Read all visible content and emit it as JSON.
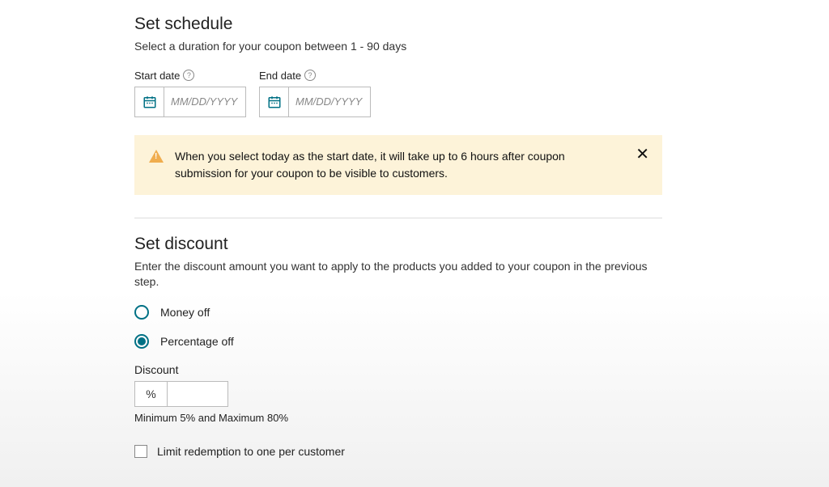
{
  "schedule": {
    "heading": "Set schedule",
    "subtext": "Select a duration for your coupon between 1 - 90 days",
    "start_label": "Start date",
    "end_label": "End date",
    "placeholder": "MM/DD/YYYY"
  },
  "alert": {
    "text": "When you select today as the start date, it will take up to 6 hours after coupon submission for your coupon to be visible to customers."
  },
  "discount": {
    "heading": "Set discount",
    "subtext": "Enter the discount amount you want to apply to the products you added to your coupon in the previous step.",
    "money_off_label": "Money off",
    "percentage_off_label": "Percentage off",
    "discount_label": "Discount",
    "pct_symbol": "%",
    "helper": "Minimum 5% and Maximum 80%",
    "limit_label": "Limit redemption to one per customer"
  }
}
